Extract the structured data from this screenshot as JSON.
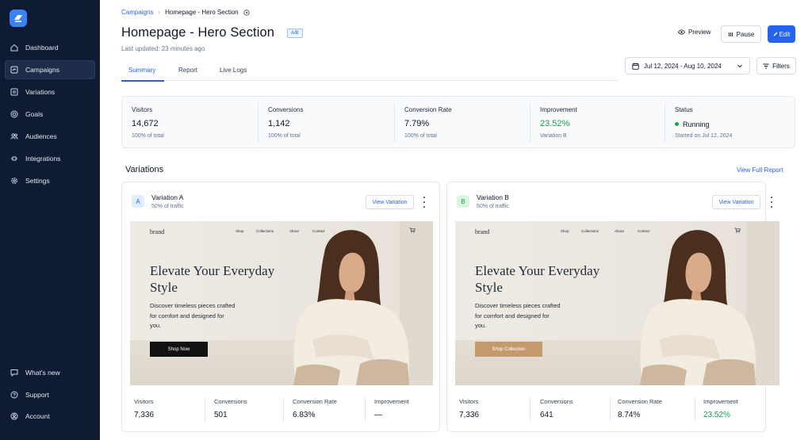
{
  "sidebar": {
    "items": [
      {
        "label": "Dashboard",
        "icon": "home-icon"
      },
      {
        "label": "Campaigns",
        "icon": "campaign-icon",
        "active": true
      },
      {
        "label": "Variations",
        "icon": "variations-icon"
      },
      {
        "label": "Goals",
        "icon": "target-icon"
      },
      {
        "label": "Audiences",
        "icon": "users-icon"
      },
      {
        "label": "Integrations",
        "icon": "integrations-icon"
      },
      {
        "label": "Settings",
        "icon": "gear-icon"
      }
    ],
    "bottom_items": [
      {
        "label": "What's new",
        "icon": "chat-icon"
      },
      {
        "label": "Support",
        "icon": "help-icon"
      },
      {
        "label": "Account",
        "icon": "account-icon"
      }
    ]
  },
  "breadcrumb": {
    "parent": "Campaigns",
    "current": "Homepage - Hero Section"
  },
  "header": {
    "title": "Homepage - Hero Section",
    "badge": "A/B",
    "updated": "Last updated: 23 minutes ago",
    "preview_label": "Preview",
    "pause_label": "Pause",
    "edit_label": "Edit"
  },
  "tabs": [
    {
      "label": "Summary",
      "active": true
    },
    {
      "label": "Report"
    },
    {
      "label": "Live Logs"
    }
  ],
  "date_range": "Jul 12, 2024 - Aug 10, 2024",
  "filters_label": "Filters",
  "stats": [
    {
      "label": "Visitors",
      "value": "14,672",
      "sub": "100% of total"
    },
    {
      "label": "Conversions",
      "value": "1,142",
      "sub": "100% of total"
    },
    {
      "label": "Conversion Rate",
      "value": "7.79%",
      "sub": "100% of total"
    },
    {
      "label": "Improvement",
      "value": "23.52%",
      "sub": "Variation B"
    },
    {
      "label": "Status",
      "value": "Running",
      "sub": "Started on Jul 12, 2024"
    }
  ],
  "variations_section": {
    "title": "Variations",
    "view_full": "View Full Report"
  },
  "variations": [
    {
      "letter": "A",
      "name": "Variation A",
      "traffic": "50% of traffic",
      "view_label": "View Variation",
      "preview": {
        "brand": "brand",
        "nav": [
          "Shop",
          "Collections",
          "About",
          "Contact"
        ],
        "headline": "Elevate Your Everyday Style",
        "description": "Discover timeless pieces crafted for comfort and designed for you.",
        "cta": "Shop Now",
        "cta_color": "#111111"
      },
      "metrics": [
        {
          "label": "Visitors",
          "value": "7,336"
        },
        {
          "label": "Conversions",
          "value": "501"
        },
        {
          "label": "Conversion Rate",
          "value": "6.83%"
        },
        {
          "label": "Improvement",
          "value": "—"
        }
      ]
    },
    {
      "letter": "B",
      "name": "Variation B",
      "traffic": "50% of traffic",
      "view_label": "View Variation",
      "preview": {
        "brand": "brand",
        "nav": [
          "Shop",
          "Collections",
          "About",
          "Contact"
        ],
        "headline": "Elevate Your Everyday Style",
        "description": "Discover timeless pieces crafted for comfort and designed for you.",
        "cta": "Shop Collection",
        "cta_color": "#c49a6c"
      },
      "metrics": [
        {
          "label": "Visitors",
          "value": "7,336"
        },
        {
          "label": "Conversions",
          "value": "641"
        },
        {
          "label": "Conversion Rate",
          "value": "8.74%"
        },
        {
          "label": "Improvement",
          "value": "23.52%"
        }
      ]
    }
  ],
  "colors": {
    "accent": "#2563eb",
    "sidebar_bg": "#0f1b33",
    "positive": "#16a34a"
  }
}
